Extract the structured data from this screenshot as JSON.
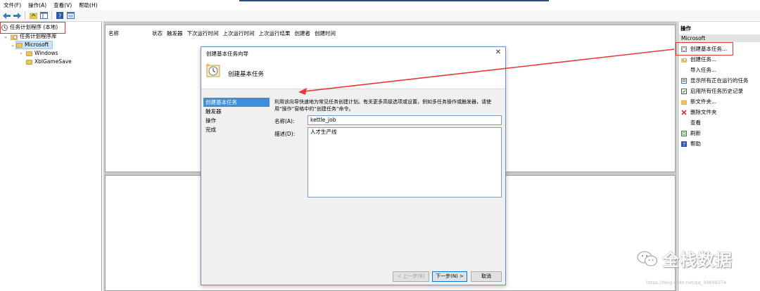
{
  "menubar": {
    "items": [
      "文件(F)",
      "操作(A)",
      "查看(V)",
      "帮助(H)"
    ]
  },
  "tree": {
    "root": "任务计划程序 (本地)",
    "library": "任务计划程序库",
    "microsoft": "Microsoft",
    "windows": "Windows",
    "xbl": "XblGameSave"
  },
  "list": {
    "columns": [
      "名称",
      "状态",
      "触发器",
      "下次运行时间",
      "上次运行时间",
      "上次运行结果",
      "创建者",
      "创建时间"
    ]
  },
  "actions": {
    "title": "操作",
    "group": "Microsoft",
    "items": [
      {
        "label": "创建基本任务...",
        "icon": "basic-task-icon"
      },
      {
        "label": "创建任务...",
        "icon": "task-icon"
      },
      {
        "label": "导入任务...",
        "icon": "import-icon"
      },
      {
        "label": "显示所有正在运行的任务",
        "icon": "running-tasks-icon"
      },
      {
        "label": "启用所有任务历史记录",
        "icon": "history-icon"
      },
      {
        "label": "新文件夹...",
        "icon": "new-folder-icon"
      },
      {
        "label": "删除文件夹",
        "icon": "delete-icon"
      },
      {
        "label": "查看",
        "icon": "view-icon"
      },
      {
        "label": "刷新",
        "icon": "refresh-icon"
      },
      {
        "label": "帮助",
        "icon": "help-icon"
      }
    ]
  },
  "dialog": {
    "title": "创建基本任务向导",
    "header": "创建基本任务",
    "nav": [
      "创建基本任务",
      "触发器",
      "操作",
      "完成"
    ],
    "description": "利用该向导快速地为常见任务创建计划。有关更多高级选项或设置，例如多任务操作或触发器，请使用“操作”窗格中的“创建任务”命令。",
    "name_label": "名称(A):",
    "name_value": "kettle_job",
    "desc_label": "描述(D):",
    "desc_value": "人才生产线",
    "buttons": {
      "back": "< 上一步(B)",
      "next": "下一步(N) >",
      "cancel": "取消"
    }
  },
  "watermark": {
    "text": "全栈数据",
    "url": "https://blog.csdn.net/qq_39699374"
  },
  "colors": {
    "accent": "#3c8fd8",
    "annotation": "#e53935"
  }
}
